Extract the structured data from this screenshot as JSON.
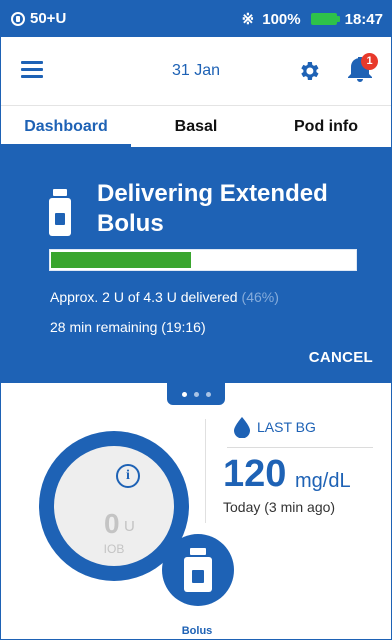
{
  "status_bar": {
    "pod_status": "50+U",
    "battery_percent": "100%",
    "time": "18:47",
    "battery_color": "#2ec24a"
  },
  "header": {
    "date": "31 Jan",
    "notification_count": "1",
    "icons": [
      "menu-icon",
      "gear-icon",
      "bell-icon"
    ]
  },
  "tabs": [
    {
      "label": "Dashboard",
      "active": true
    },
    {
      "label": "Basal",
      "active": false
    },
    {
      "label": "Pod info",
      "active": false
    }
  ],
  "delivery": {
    "title": "Delivering Extended Bolus",
    "progress": 0.46,
    "delivered_text": "Approx. 2 U of 4.3 U delivered",
    "percent_text": "(46%)",
    "remaining_text": "28 min remaining (19:16)",
    "cancel_label": "CANCEL"
  },
  "pager": {
    "count": 3,
    "active": 0
  },
  "iob": {
    "value": "0",
    "unit": "U",
    "label": "IOB"
  },
  "last_bg": {
    "label": "LAST BG",
    "value": "120",
    "unit": "mg/dL",
    "time": "Today (3 min ago)"
  },
  "bolus_button": {
    "label": "Bolus"
  },
  "colors": {
    "brand_blue": "#1e62b5",
    "progress_green": "#3aa52e",
    "alert_red": "#e8392b"
  }
}
